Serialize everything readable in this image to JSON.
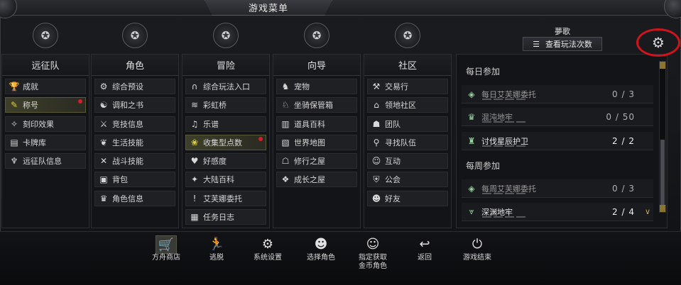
{
  "window": {
    "title": "游戏菜单"
  },
  "columns": [
    {
      "title": "远征队",
      "emblem": "crest-icon",
      "items": [
        {
          "label": "成就",
          "icon": "trophy-icon",
          "glyph": "🏆"
        },
        {
          "label": "称号",
          "icon": "title-icon",
          "glyph": "✎",
          "selected": true,
          "badge": true
        },
        {
          "label": "刻印效果",
          "icon": "engraving-icon",
          "glyph": "✧"
        },
        {
          "label": "卡牌库",
          "icon": "card-icon",
          "glyph": "▤"
        },
        {
          "label": "远征队信息",
          "icon": "expedition-icon",
          "glyph": "♆"
        }
      ]
    },
    {
      "title": "角色",
      "emblem": "helmet-icon",
      "items": [
        {
          "label": "综合预设",
          "icon": "preset-icon",
          "glyph": "⚙"
        },
        {
          "label": "调和之书",
          "icon": "book-icon",
          "glyph": "☯"
        },
        {
          "label": "竞技信息",
          "icon": "arena-icon",
          "glyph": "⚔"
        },
        {
          "label": "生活技能",
          "icon": "life-skill-icon",
          "glyph": "❦"
        },
        {
          "label": "战斗技能",
          "icon": "combat-skill-icon",
          "glyph": "✕"
        },
        {
          "label": "背包",
          "icon": "bag-icon",
          "glyph": "▣"
        },
        {
          "label": "角色信息",
          "icon": "character-icon",
          "glyph": "♛"
        }
      ]
    },
    {
      "title": "冒险",
      "emblem": "open-book-icon",
      "items": [
        {
          "label": "综合玩法入口",
          "icon": "portal-icon",
          "glyph": "∩"
        },
        {
          "label": "彩虹桥",
          "icon": "bridge-icon",
          "glyph": "≋"
        },
        {
          "label": "乐谱",
          "icon": "music-icon",
          "glyph": "♫"
        },
        {
          "label": "收集型点数",
          "icon": "collectible-icon",
          "glyph": "❀",
          "selected": true,
          "badge": true
        },
        {
          "label": "好感度",
          "icon": "heart-icon",
          "glyph": "♥"
        },
        {
          "label": "大陆百科",
          "icon": "encyclopedia-icon",
          "glyph": "✦"
        },
        {
          "label": "艾芙娜委托",
          "icon": "exclamation-icon",
          "glyph": "!"
        },
        {
          "label": "任务日志",
          "icon": "journal-icon",
          "glyph": "▦"
        }
      ]
    },
    {
      "title": "向导",
      "emblem": "crosshair-icon",
      "items": [
        {
          "label": "宠物",
          "icon": "pet-icon",
          "glyph": "♞"
        },
        {
          "label": "坐骑保管箱",
          "icon": "mount-icon",
          "glyph": "♘"
        },
        {
          "label": "道具百科",
          "icon": "item-book-icon",
          "glyph": "▥"
        },
        {
          "label": "世界地图",
          "icon": "map-icon",
          "glyph": "▧"
        },
        {
          "label": "修行之屋",
          "icon": "training-icon",
          "glyph": "☖"
        },
        {
          "label": "成长之屋",
          "icon": "growth-icon",
          "glyph": "❖"
        }
      ]
    },
    {
      "title": "社区",
      "emblem": "chat-icon",
      "items": [
        {
          "label": "交易行",
          "icon": "gavel-icon",
          "glyph": "⚒"
        },
        {
          "label": "领地社区",
          "icon": "house-icon",
          "glyph": "⌂"
        },
        {
          "label": "团队",
          "icon": "team-icon",
          "glyph": "☗"
        },
        {
          "label": "寻找队伍",
          "icon": "search-party-icon",
          "glyph": "⚲"
        },
        {
          "label": "互动",
          "icon": "interact-icon",
          "glyph": "☺"
        },
        {
          "label": "公会",
          "icon": "guild-icon",
          "glyph": "⛨"
        },
        {
          "label": "好友",
          "icon": "friends-icon",
          "glyph": "☻"
        }
      ]
    }
  ],
  "right_panel": {
    "character_name": "夢歌",
    "view_count_button": "查看玩法次数",
    "daily_title": "每日参加",
    "weekly_title": "每周参加",
    "daily": [
      {
        "label": "每日艾芙娜委托",
        "count": "0 / 3",
        "icon": "emblem-icon",
        "glyph": "◈"
      },
      {
        "label": "混沌地牢",
        "count": "0 / 50",
        "icon": "chaos-icon",
        "glyph": "♛"
      },
      {
        "label": "讨伐星辰护卫",
        "count": "2 / 2",
        "icon": "guardian-icon",
        "glyph": "♜",
        "active": true
      }
    ],
    "weekly": [
      {
        "label": "每周艾芙娜委托",
        "count": "0 / 3",
        "icon": "weekly-emblem-icon",
        "glyph": "◈"
      },
      {
        "label": "深渊地牢",
        "count": "2 / 4",
        "icon": "abyss-icon",
        "glyph": "⩔",
        "active": true
      }
    ]
  },
  "bottom_bar": [
    {
      "label": "方舟商店",
      "icon": "cart-icon",
      "glyph": "🛒",
      "highlight": true
    },
    {
      "label": "逃脱",
      "icon": "run-icon",
      "glyph": "🏃"
    },
    {
      "label": "系统设置",
      "icon": "settings-icon",
      "glyph": "⚙"
    },
    {
      "label": "选择角色",
      "icon": "select-character-icon",
      "glyph": "☻"
    },
    {
      "label": "指定获取\n金币角色",
      "icon": "gold-character-icon",
      "glyph": "☺"
    },
    {
      "label": "返回",
      "icon": "return-icon",
      "glyph": "↩"
    },
    {
      "label": "游戏结束",
      "icon": "power-icon",
      "glyph": "⏻"
    }
  ],
  "colors": {
    "accent_gold": "#c8a458",
    "badge_red": "#d81c28",
    "highlight_circle": "#d0141c"
  }
}
